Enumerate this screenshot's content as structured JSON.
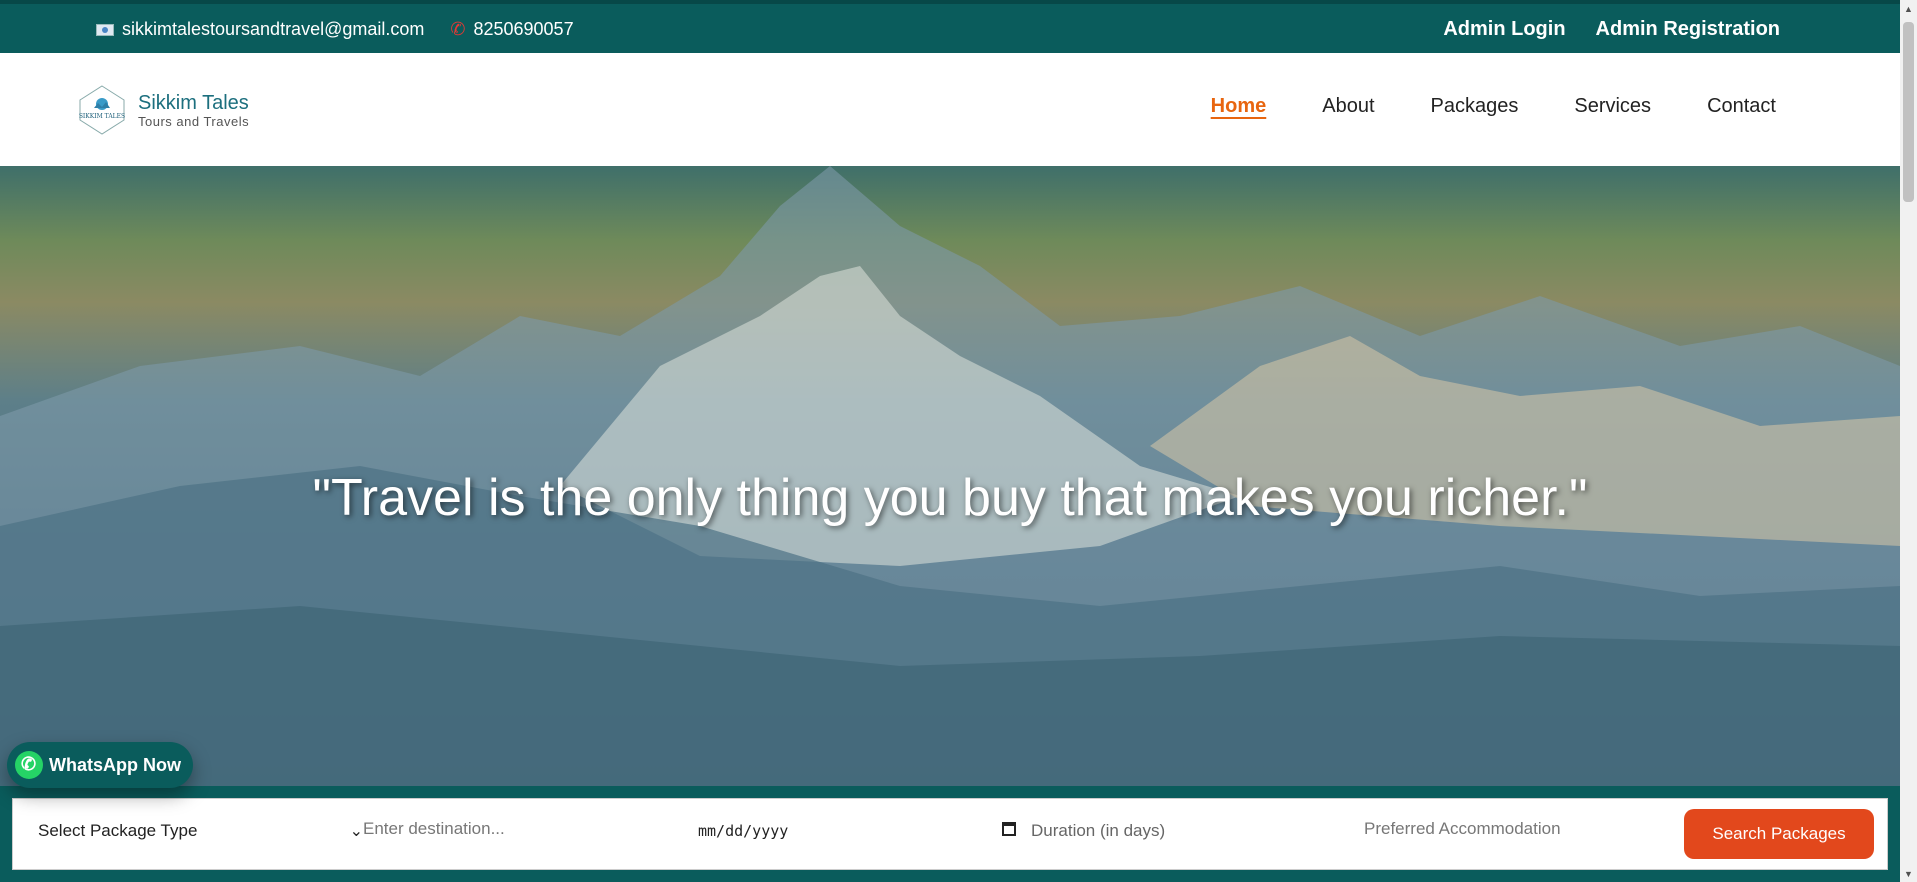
{
  "topbar": {
    "email": "sikkimtalestoursandtravel@gmail.com",
    "phone": "8250690057",
    "admin_login": "Admin Login",
    "admin_registration": "Admin Registration"
  },
  "brand": {
    "name": "Sikkim Tales",
    "tagline": "Tours and Travels",
    "logo_text": "SIKKIM TALES"
  },
  "nav": {
    "items": [
      "Home",
      "About",
      "Packages",
      "Services",
      "Contact"
    ],
    "active": "Home"
  },
  "hero": {
    "quote": "\"Travel is the only thing you buy that makes you richer.\""
  },
  "whatsapp": {
    "label": "WhatsApp Now"
  },
  "search": {
    "package_type": "Select Package Type",
    "destination_placeholder": "Enter destination...",
    "date_placeholder": "mm/dd/yyyy",
    "duration_placeholder": "Duration (in days)",
    "accommodation_placeholder": "Preferred Accommodation",
    "button": "Search Packages"
  },
  "colors": {
    "primary": "#0a5c5c",
    "accent": "#e8650f",
    "button": "#e2481c"
  },
  "icons": [
    "mail-icon",
    "phone-icon",
    "whatsapp-icon",
    "calendar-icon",
    "chevron-down-icon"
  ]
}
